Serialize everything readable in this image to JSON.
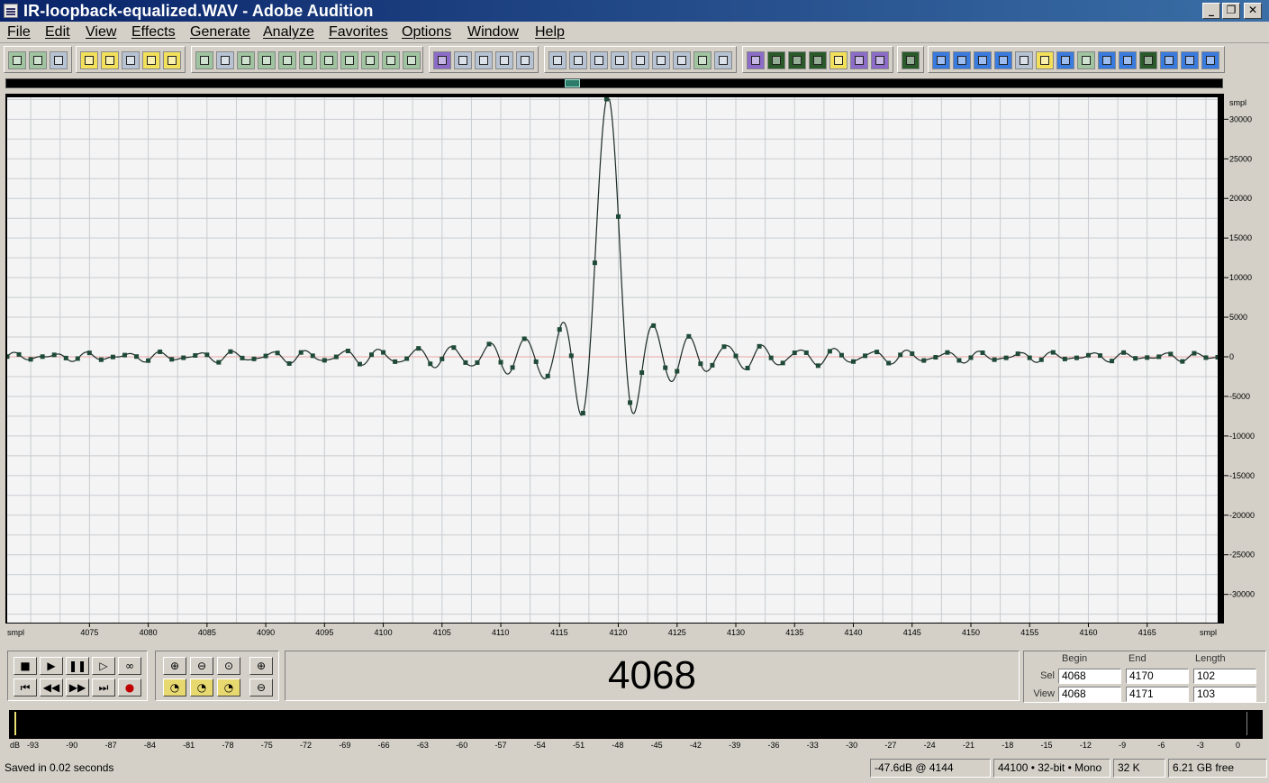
{
  "titlebar": {
    "title": "IR-loopback-equalized.WAV - Adobe Audition",
    "minimize": "_",
    "restore": "❐",
    "close": "✕"
  },
  "menubar": {
    "items": [
      "File",
      "Edit",
      "View",
      "Effects",
      "Generate",
      "Analyze",
      "Favorites",
      "Options",
      "Window",
      "Help"
    ]
  },
  "waveform": {
    "ruler_right_unit": "smpl",
    "ruler_bottom_unit": "smpl",
    "amplitude_ticks": [
      30000,
      25000,
      20000,
      15000,
      10000,
      5000,
      0,
      -5000,
      -10000,
      -15000,
      -20000,
      -25000,
      -30000
    ],
    "sample_ticks": [
      4075,
      4080,
      4085,
      4090,
      4095,
      4100,
      4105,
      4110,
      4115,
      4120,
      4125,
      4130,
      4135,
      4140,
      4145,
      4150,
      4155,
      4160,
      4165
    ],
    "view_begin": 4068,
    "view_end": 4171,
    "waveform_color": "#1a2a24",
    "background_color": "#f4f4f4",
    "grid_color": "#c8ccd0"
  },
  "transport": {
    "buttons": [
      "stop",
      "play",
      "pause",
      "play-to-end",
      "loop",
      "go-to-start",
      "rewind",
      "fast-forward",
      "go-to-end",
      "record"
    ],
    "stop": "■",
    "play": "▶",
    "pause": "❚❚",
    "play_end": "▷",
    "loop": "∞",
    "to_start": "⏮",
    "rew": "◀◀",
    "ffwd": "▶▶",
    "to_end": "⏭",
    "rec": "●"
  },
  "time_display": "4068",
  "selection_view": {
    "headers": {
      "begin": "Begin",
      "end": "End",
      "length": "Length"
    },
    "sel": {
      "label": "Sel",
      "begin": "4068",
      "end": "4170",
      "length": "102"
    },
    "view": {
      "label": "View",
      "begin": "4068",
      "end": "4171",
      "length": "103"
    }
  },
  "meter": {
    "unit": "dB",
    "scale": [
      -93,
      -90,
      -87,
      -84,
      -81,
      -78,
      -75,
      -72,
      -69,
      -66,
      -63,
      -60,
      -57,
      -54,
      -51,
      -48,
      -45,
      -42,
      -39,
      -36,
      -33,
      -30,
      -27,
      -24,
      -21,
      -18,
      -15,
      -12,
      -9,
      -6,
      -3,
      0
    ]
  },
  "statusbar": {
    "message": "Saved in 0.02 seconds",
    "level": "-47.6dB @ 4144",
    "format": "44100 • 32-bit • Mono",
    "size": "32 K",
    "free": "6.21 GB free"
  }
}
